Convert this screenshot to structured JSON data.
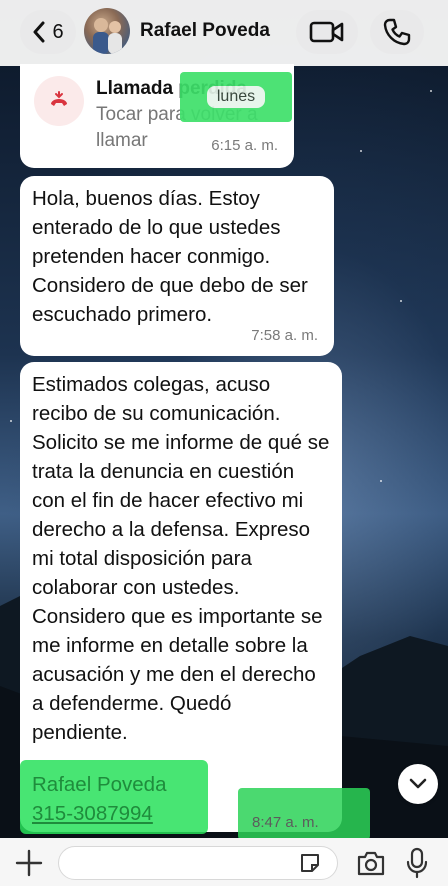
{
  "header": {
    "back_count": "6",
    "contact_name": "Rafael Poveda"
  },
  "missed_call": {
    "title": "Llamada perdida",
    "subtitle": "Tocar para volver a llamar",
    "time": "6:15 a. m."
  },
  "day_divider": "lunes",
  "messages": [
    {
      "text": "Hola, buenos días.  Estoy enterado de lo que ustedes pretenden hacer conmigo. Considero de que debo de ser escuchado primero.",
      "time": "7:58 a. m."
    },
    {
      "text": "Estimados colegas, acuso recibo de su comunicación. Solicito se me informe de qué se trata la denuncia en cuestión con el fin de hacer efectivo mi derecho a la defensa. Expreso mi total disposición para colaborar con ustedes. Considero que es importante se me informe en detalle sobre la acusación y me den el derecho a defenderme. Quedó pendiente.",
      "signature_name": "Rafael Poveda",
      "signature_phone": "315-3087994",
      "time": "8:47 a. m."
    }
  ],
  "colors": {
    "highlight_green": "#2bd257",
    "missed_red": "#d9343f",
    "link_green": "#1f8c3c"
  },
  "icons": [
    "chevron-left-icon",
    "video-camera-icon",
    "phone-icon",
    "missed-call-icon",
    "chevron-down-icon",
    "plus-icon",
    "sticker-icon",
    "camera-icon",
    "microphone-icon"
  ]
}
